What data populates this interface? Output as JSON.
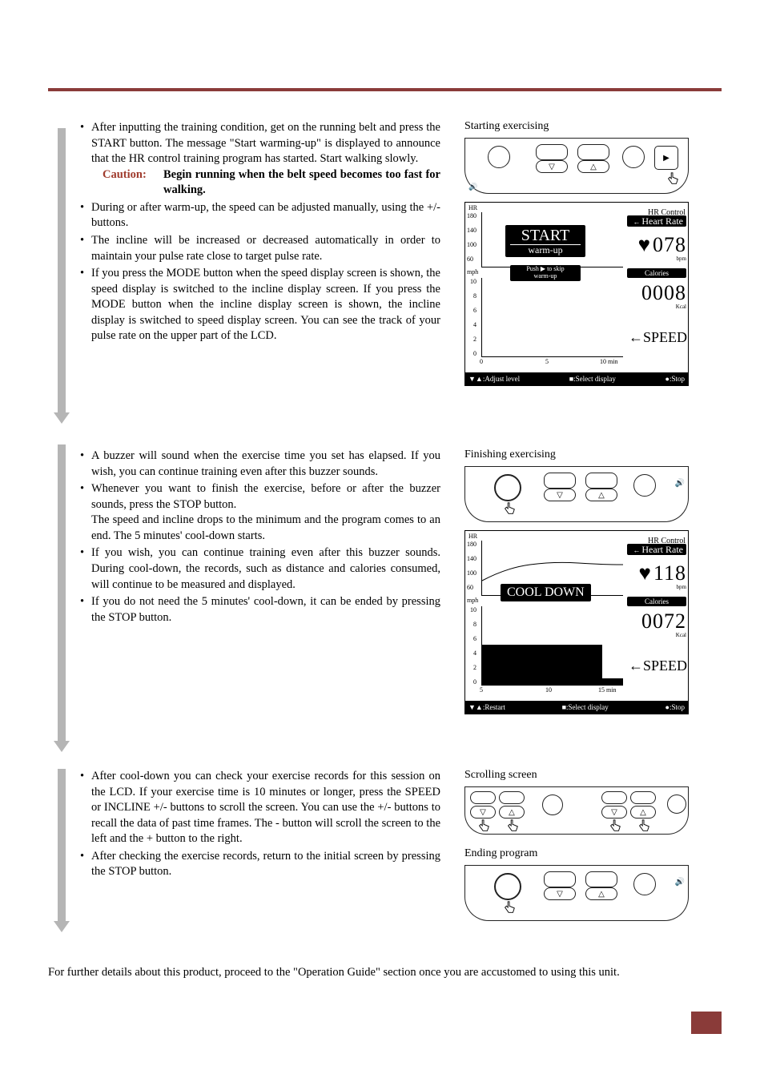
{
  "sections": {
    "start": {
      "title": "Starting exercising",
      "bullets": {
        "b1": "After inputting the training condition, get on the running belt and press the START button. The message \"Start warming-up\" is displayed to announce that the HR control training program has started. Start walking slowly.",
        "caution_label": "Caution:",
        "caution_text": "Begin running when the belt speed becomes too fast for walking.",
        "b2": "During or after warm-up, the speed can be adjusted manually, using the +/- buttons.",
        "b3": "The incline will be increased or decreased automatically in order to maintain your pulse rate close to target pulse rate.",
        "b4": "If you press the MODE button when the speed display screen is shown, the speed display is switched to the incline display screen. If you press the MODE button when the incline display screen is shown, the incline display is switched to speed display screen. You can see the track of your pulse rate on the upper part of the LCD."
      }
    },
    "finish": {
      "title": "Finishing exercising",
      "bullets": {
        "b1": "A buzzer will sound when the exercise time you set has elapsed. If you wish, you can continue training even after this buzzer sounds.",
        "b2": "Whenever you want to finish the exercise, before or after the buzzer sounds, press the STOP button.",
        "b2b": "The speed and incline drops to the minimum and the program comes to an end. The 5 minutes' cool-down starts.",
        "b3": "If you wish, you can continue training even after this buzzer sounds. During cool-down, the records, such as distance and calories consumed, will continue to be measured and displayed.",
        "b4": "If you do not need the 5 minutes' cool-down, it can be ended by pressing the STOP button."
      }
    },
    "scroll": {
      "title": "Scrolling screen",
      "end_title": "Ending program",
      "bullets": {
        "b1": "After cool-down you can check your exercise records for this session on the LCD. If your exercise time is 10 minutes or longer, press the SPEED or INCLINE +/- buttons to scroll the screen. You can use the +/- buttons to recall the data of past time frames. The - button will scroll the screen to the left and the + button to the right.",
        "b2": "After checking the exercise records, return to the initial screen by pressing the STOP button."
      }
    }
  },
  "lcd1": {
    "mode": "HR Control",
    "hr_label": "Heart Rate",
    "hr_value": "078",
    "hr_unit": "bpm",
    "cal_label": "Calories",
    "cal_value": "0008",
    "cal_unit": "Kcal",
    "speed_label": "SPEED",
    "start_big": "START",
    "start_small": "warm-up",
    "push_line1": "Push ▶ to skip",
    "push_line2": "warm-up",
    "footer_left": ":Adjust level",
    "footer_mid": ":Select display",
    "footer_right": ":Stop",
    "y_hr": [
      "180",
      "140",
      "100",
      "60"
    ],
    "y_mph": [
      "10",
      "8",
      "6",
      "4",
      "2",
      "0"
    ],
    "x_ticks": [
      "0",
      "5",
      "10 min"
    ],
    "hr_axis": "HR",
    "mph_axis": "mph"
  },
  "lcd2": {
    "mode": "HR Control",
    "hr_label": "Heart Rate",
    "hr_value": "118",
    "hr_unit": "bpm",
    "cal_label": "Calories",
    "cal_value": "0072",
    "cal_unit": "Kcal",
    "speed_label": "SPEED",
    "cooldown": "COOL DOWN",
    "footer_left": ":Restart",
    "footer_mid": ":Select display",
    "footer_right": ":Stop",
    "y_hr": [
      "180",
      "140",
      "100",
      "60"
    ],
    "y_mph": [
      "10",
      "8",
      "6",
      "4",
      "2",
      "0"
    ],
    "x_ticks": [
      "5",
      "10",
      "15 min"
    ],
    "hr_axis": "HR",
    "mph_axis": "mph"
  },
  "footer": "For further details about this product, proceed to the \"Operation Guide\" section once you are accustomed to using this unit."
}
